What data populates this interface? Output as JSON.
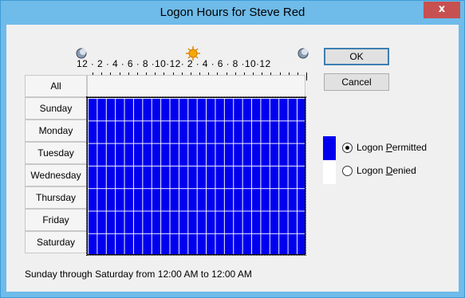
{
  "window": {
    "title": "Logon Hours for Steve Red",
    "close_label": "x"
  },
  "hours_scale": {
    "labels": [
      "12",
      "2",
      "4",
      "6",
      "8",
      "10",
      "12",
      "2",
      "4",
      "6",
      "8",
      "10",
      "12"
    ],
    "text": "12 · 2 · 4 · 6 · 8 ·10·12· 2 · 4 · 6 · 8 ·10·12",
    "icons": [
      "moon-icon",
      "sun-icon",
      "moon-icon"
    ]
  },
  "days": {
    "all_label": "All",
    "items": [
      "Sunday",
      "Monday",
      "Tuesday",
      "Wednesday",
      "Thursday",
      "Friday",
      "Saturday"
    ]
  },
  "grid": {
    "permitted_color": "#0000ee",
    "denied_color": "#ffffff",
    "state": "all-permitted"
  },
  "buttons": {
    "ok": "OK",
    "cancel": "Cancel"
  },
  "legend": {
    "permitted_prefix": "Logon ",
    "permitted_ul": "P",
    "permitted_rest": "ermitted",
    "denied_prefix": "Logon ",
    "denied_ul": "D",
    "denied_rest": "enied",
    "selected": "permitted"
  },
  "status": {
    "text": "Sunday through Saturday from 12:00 AM to 12:00 AM"
  }
}
